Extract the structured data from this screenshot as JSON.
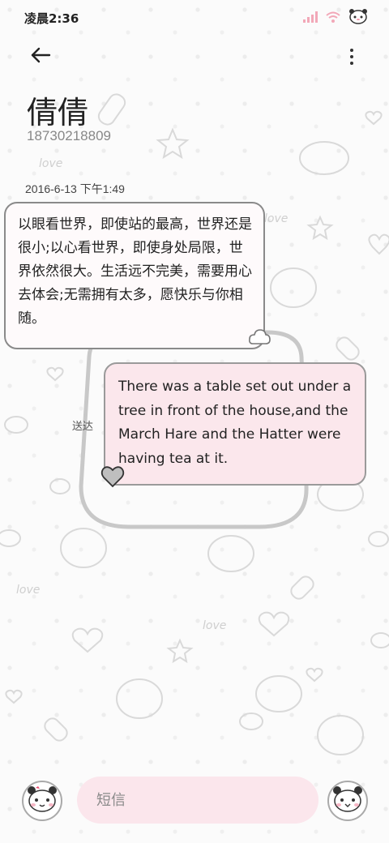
{
  "status_bar": {
    "time": "凌晨2:36",
    "icons": [
      "signal-icon",
      "wifi-icon",
      "panda-battery-icon"
    ]
  },
  "header": {
    "back_icon": "arrow-left-icon",
    "more_icon": "more-vertical-icon",
    "contact_name": "倩倩",
    "contact_phone": "18730218809"
  },
  "conversation": {
    "timestamp": "2016-6-13 下午1:49",
    "incoming_message": "以眼看世界，即使站的最高，世界还是很小;以心看世界，即使身处局限，世界依然很大。生活远不完美，需要用心去体会;无需拥有太多，愿快乐与你相随。",
    "outgoing_message": "There was a table set out under a tree in front of the house,and the March Hare and the Hatter were having tea at it.",
    "outgoing_status": "送达"
  },
  "compose": {
    "placeholder": "短信",
    "left_button_icon": "panda-emoji-icon",
    "right_button_icon": "panda-send-icon"
  },
  "colors": {
    "outgoing_bubble": "#fbe7ec",
    "incoming_bubble": "#fefafb",
    "compose_field": "#fbe6ec",
    "background": "#fbfbfb"
  }
}
